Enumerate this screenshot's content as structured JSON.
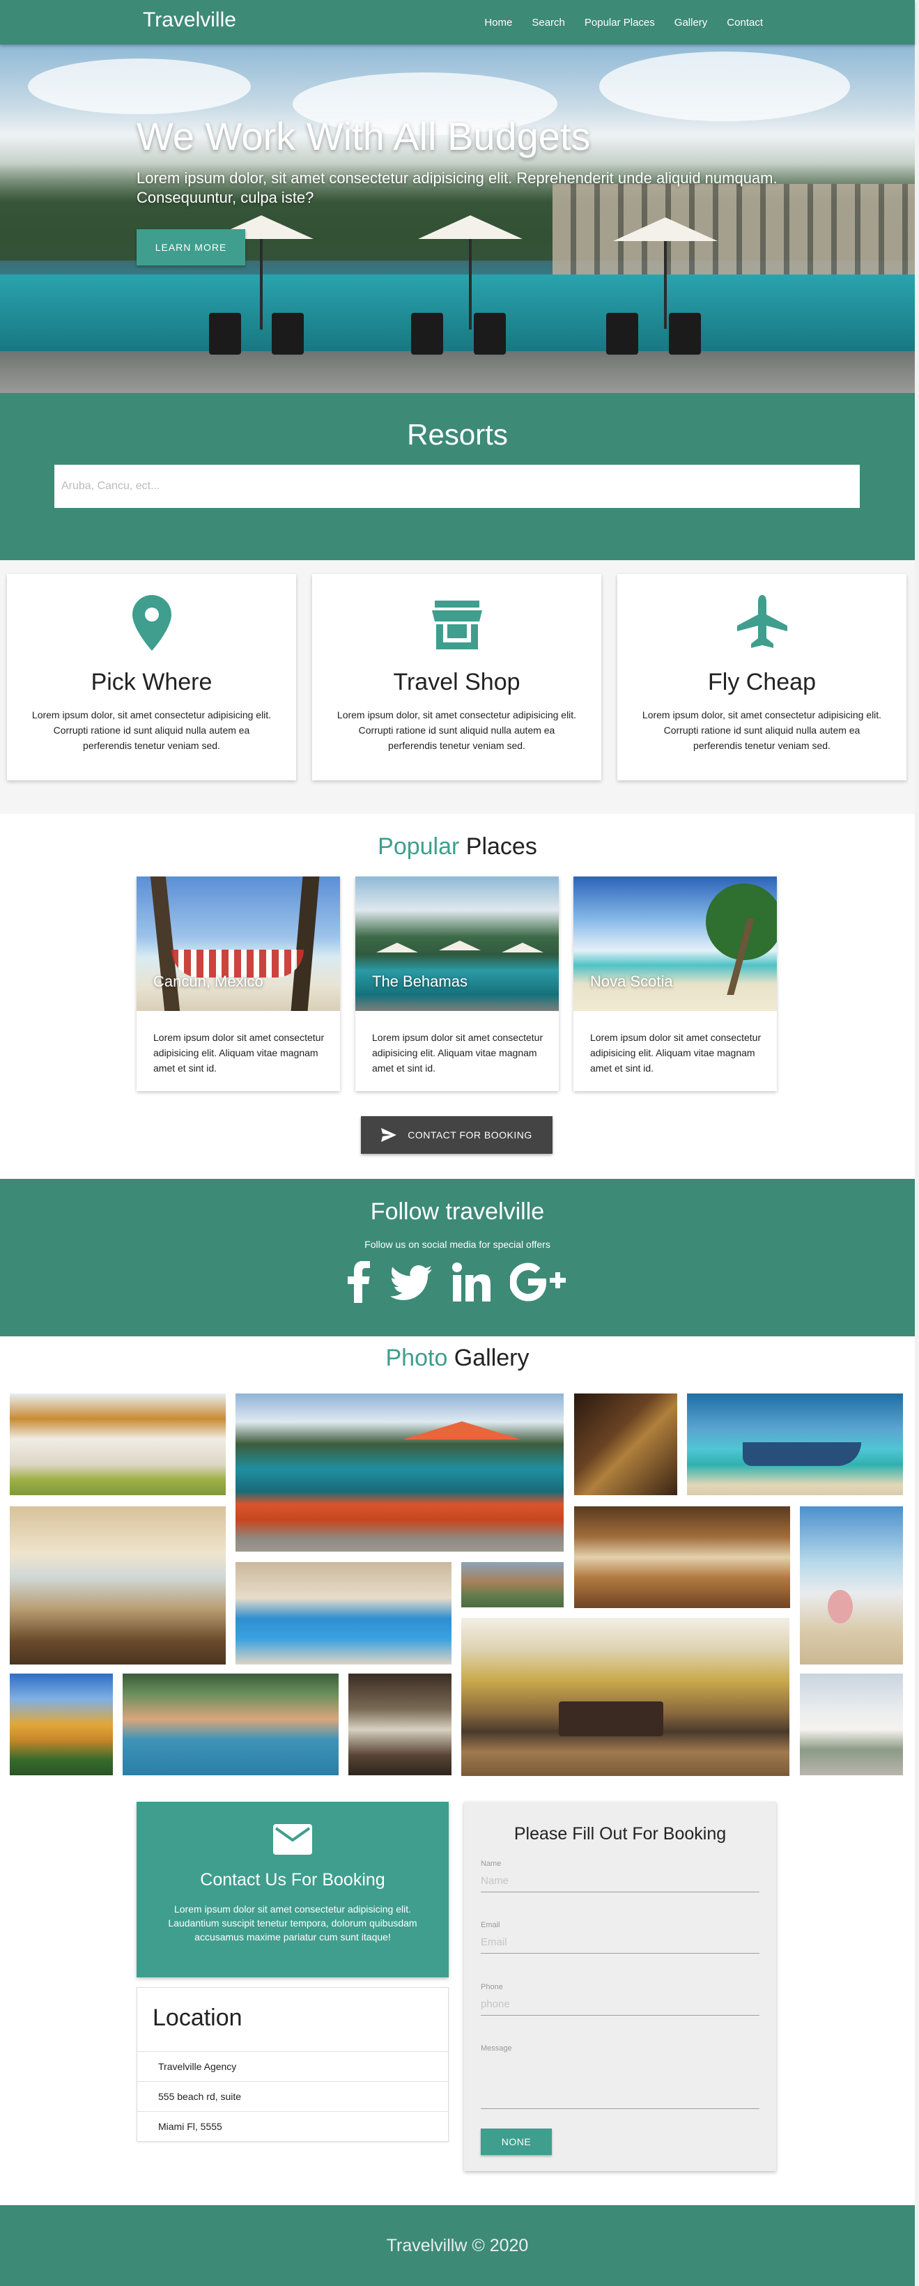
{
  "brand": "Travelville",
  "nav": {
    "items": [
      "Home",
      "Search",
      "Popular Places",
      "Gallery",
      "Contact"
    ]
  },
  "hero": {
    "title": "We Work With All Budgets",
    "text": "Lorem ipsum dolor, sit amet consectetur adipisicing elit. Reprehenderit unde aliquid numquam. Consequuntur, culpa iste?",
    "button_label": "LEARN MORE"
  },
  "resorts": {
    "title": "Resorts",
    "search_placeholder": "Aruba, Cancu, ect..."
  },
  "features": [
    {
      "icon": "map-pin-icon",
      "title": "Pick Where",
      "text": "Lorem ipsum dolor, sit amet consectetur adipisicing elit. Corrupti ratione id sunt aliquid nulla autem ea perferendis tenetur veniam sed."
    },
    {
      "icon": "store-icon",
      "title": "Travel Shop",
      "text": "Lorem ipsum dolor, sit amet consectetur adipisicing elit. Corrupti ratione id sunt aliquid nulla autem ea perferendis tenetur veniam sed."
    },
    {
      "icon": "airplane-icon",
      "title": "Fly Cheap",
      "text": "Lorem ipsum dolor, sit amet consectetur adipisicing elit. Corrupti ratione id sunt aliquid nulla autem ea perferendis tenetur veniam sed."
    }
  ],
  "popular": {
    "title_accent": "Popular",
    "title_rest": " Places",
    "places": [
      {
        "name": "Cancun, Mexico",
        "text": "Lorem ipsum dolor sit amet consectetur adipisicing elit. Aliquam vitae magnam amet et sint id."
      },
      {
        "name": "The Behamas",
        "text": "Lorem ipsum dolor sit amet consectetur adipisicing elit. Aliquam vitae magnam amet et sint id."
      },
      {
        "name": "Nova Scotia",
        "text": "Lorem ipsum dolor sit amet consectetur adipisicing elit. Aliquam vitae magnam amet et sint id."
      }
    ],
    "button_label": "CONTACT FOR BOOKING"
  },
  "follow": {
    "title": "Follow travelville",
    "subtitle": "Follow us on social media for special offers",
    "icons": [
      "facebook-icon",
      "twitter-icon",
      "linkedin-icon",
      "google-plus-icon"
    ]
  },
  "gallery": {
    "title_accent": "Photo",
    "title_rest": " Gallery"
  },
  "contact": {
    "title": "Contact Us For Booking",
    "text": "Lorem ipsum dolor sit amet consectetur adipisicing elit. Laudantium suscipit tenetur tempora, dolorum quibusdam accusamus maxime pariatur cum sunt itaque!"
  },
  "location": {
    "title": "Location",
    "lines": [
      "Travelville Agency",
      "555 beach rd, suite",
      "Miami Fl, 5555"
    ]
  },
  "form": {
    "title": "Please Fill Out For Booking",
    "name_label": "Name",
    "name_placeholder": "Name",
    "email_label": "Email",
    "email_placeholder": "Email",
    "phone_label": "Phone",
    "phone_placeholder": "phone",
    "message_label": "Message",
    "button_label": "NONE"
  },
  "footer": {
    "text": "Travelvillw © 2020"
  },
  "colors": {
    "primary": "#3d8a77",
    "accent": "#3f9e8d",
    "dark_button": "#444444"
  }
}
